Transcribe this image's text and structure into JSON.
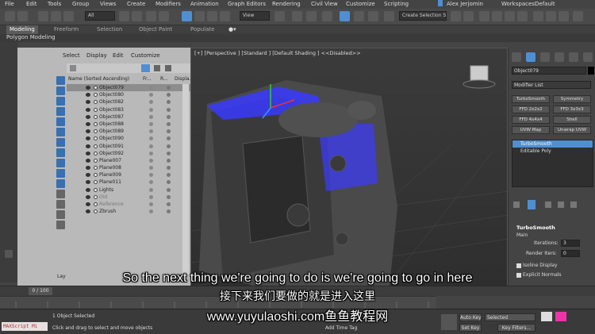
{
  "menu": [
    "File",
    "Edit",
    "Tools",
    "Group",
    "Views",
    "Create",
    "Modifiers",
    "Animation",
    "Graph Editors",
    "Rendering",
    "Civil View",
    "Customize",
    "Scripting"
  ],
  "user": {
    "name": "Alex Jerjomin",
    "workspaces_label": "Workspaces:",
    "workspace_value": "Default"
  },
  "toolbar": {
    "filter_select": "All",
    "view_select": "View",
    "selection_set": "Create Selection Se"
  },
  "ribbon": {
    "tabs": [
      "Modeling",
      "Freeform",
      "Selection",
      "Object Paint",
      "Populate"
    ],
    "active_tab": "Modeling",
    "sub_label": "Polygon Modeling"
  },
  "scene_explorer": {
    "menu": [
      "Select",
      "Display",
      "Edit",
      "Customize"
    ],
    "columns": [
      "Name (Sorted Ascending)",
      "Fr...",
      "R...",
      "Displa..."
    ],
    "rows": [
      {
        "name": "Object079",
        "state": "selected"
      },
      {
        "name": "Object080",
        "state": "normal"
      },
      {
        "name": "Object082",
        "state": "normal"
      },
      {
        "name": "Object083",
        "state": "normal"
      },
      {
        "name": "Object087",
        "state": "normal"
      },
      {
        "name": "Object088",
        "state": "normal"
      },
      {
        "name": "Object089",
        "state": "normal"
      },
      {
        "name": "Object090",
        "state": "normal"
      },
      {
        "name": "Object091",
        "state": "normal"
      },
      {
        "name": "Object092",
        "state": "normal"
      },
      {
        "name": "Plane007",
        "state": "normal"
      },
      {
        "name": "Plane008",
        "state": "normal"
      },
      {
        "name": "Plane009",
        "state": "normal"
      },
      {
        "name": "Plane011",
        "state": "normal"
      },
      {
        "name": "Lights",
        "state": "group"
      },
      {
        "name": "Old",
        "state": "dim"
      },
      {
        "name": "Reference",
        "state": "dim"
      },
      {
        "name": "Zbrush",
        "state": "group"
      }
    ],
    "layer_label": "Lay"
  },
  "viewport": {
    "label": "[+] [Perspective ] [Standard ] [Default Shading ]  <<Disabled>>"
  },
  "command_panel": {
    "object_name": "Object079",
    "modifier_list": "Modifier List",
    "modifier_buttons": [
      "TurboSmooth",
      "Symmetry",
      "FFD 2x2x2",
      "FFD 3x3x3",
      "FFD 4x4x4",
      "Shell",
      "UVW Map",
      "Unwrap UVW"
    ],
    "stack": [
      "TurboSmooth",
      "Editable Poly"
    ],
    "rollout_title": "TurboSmooth",
    "main_label": "Main",
    "iterations_label": "Iterations:",
    "iterations_value": "3",
    "render_iters_label": "Render Iters:",
    "render_iters_value": "0",
    "isoline_label": "Isoline Display",
    "explicit_label": "Explicit Normals"
  },
  "timeline": {
    "frame_display": "0 / 100"
  },
  "status": {
    "maxscript": "MAXScript Mi",
    "selected": "1 Object Selected",
    "prompt": "Click and drag to select and move objects",
    "add_time_tag": "Add Time Tag",
    "auto_key": "Auto Key",
    "set_key": "Set Key",
    "selected_dropdown": "Selected",
    "key_filters": "Key Filters..."
  },
  "subtitles": {
    "english": "So the next thing we're going to do is we're going to go in here",
    "chinese": "接下来我们要做的就是进入这里",
    "watermark": "www.yuyulaoshi.com鱼鱼教程网"
  },
  "colors": {
    "accent": "#4f8fd1",
    "selection_blue": "#3a3aff",
    "explorer_bg": "#b9b9b9"
  }
}
